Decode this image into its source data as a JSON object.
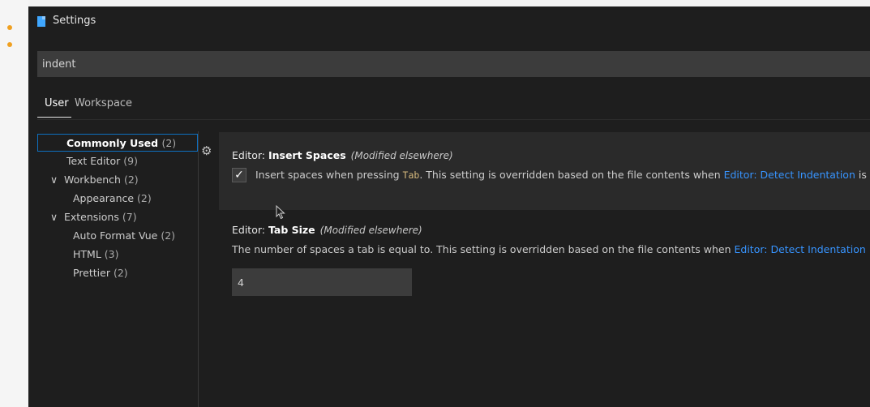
{
  "window": {
    "title": "Settings",
    "icon": "file-icon"
  },
  "search": {
    "value": "indent"
  },
  "tabs": [
    {
      "label": "User",
      "active": true
    },
    {
      "label": "Workspace",
      "active": false
    }
  ],
  "tree": [
    {
      "label": "Commonly Used",
      "count": "(2)",
      "selected": true
    },
    {
      "label": "Text Editor",
      "count": "(9)"
    },
    {
      "label": "Workbench",
      "count": "(2)",
      "chevron": "∨"
    },
    {
      "label": "Appearance",
      "count": "(2)"
    },
    {
      "label": "Extensions",
      "count": "(7)",
      "chevron": "∨"
    },
    {
      "label": "Auto Format Vue",
      "count": "(2)"
    },
    {
      "label": "HTML",
      "count": "(3)"
    },
    {
      "label": "Prettier",
      "count": "(2)"
    }
  ],
  "settings": {
    "insert_spaces": {
      "category": "Editor: ",
      "name": "Insert Spaces",
      "modified": "(Modified elsewhere)",
      "checked": true,
      "check_glyph": "✓",
      "desc_before": "Insert spaces when pressing ",
      "desc_code": "Tab",
      "desc_after": ". This setting is overridden based on the file contents when ",
      "desc_link": "Editor: Detect Indentation",
      "desc_tail": " is"
    },
    "tab_size": {
      "category": "Editor: ",
      "name": "Tab Size",
      "modified": "(Modified elsewhere)",
      "desc_before": "The number of spaces a tab is equal to. This setting is overridden based on the file contents when ",
      "desc_link": "Editor: Detect Indentation",
      "value": "4"
    }
  },
  "colors": {
    "accent": "#3794ff",
    "selection_border": "#0e70c0",
    "background": "#1e1e1e"
  }
}
